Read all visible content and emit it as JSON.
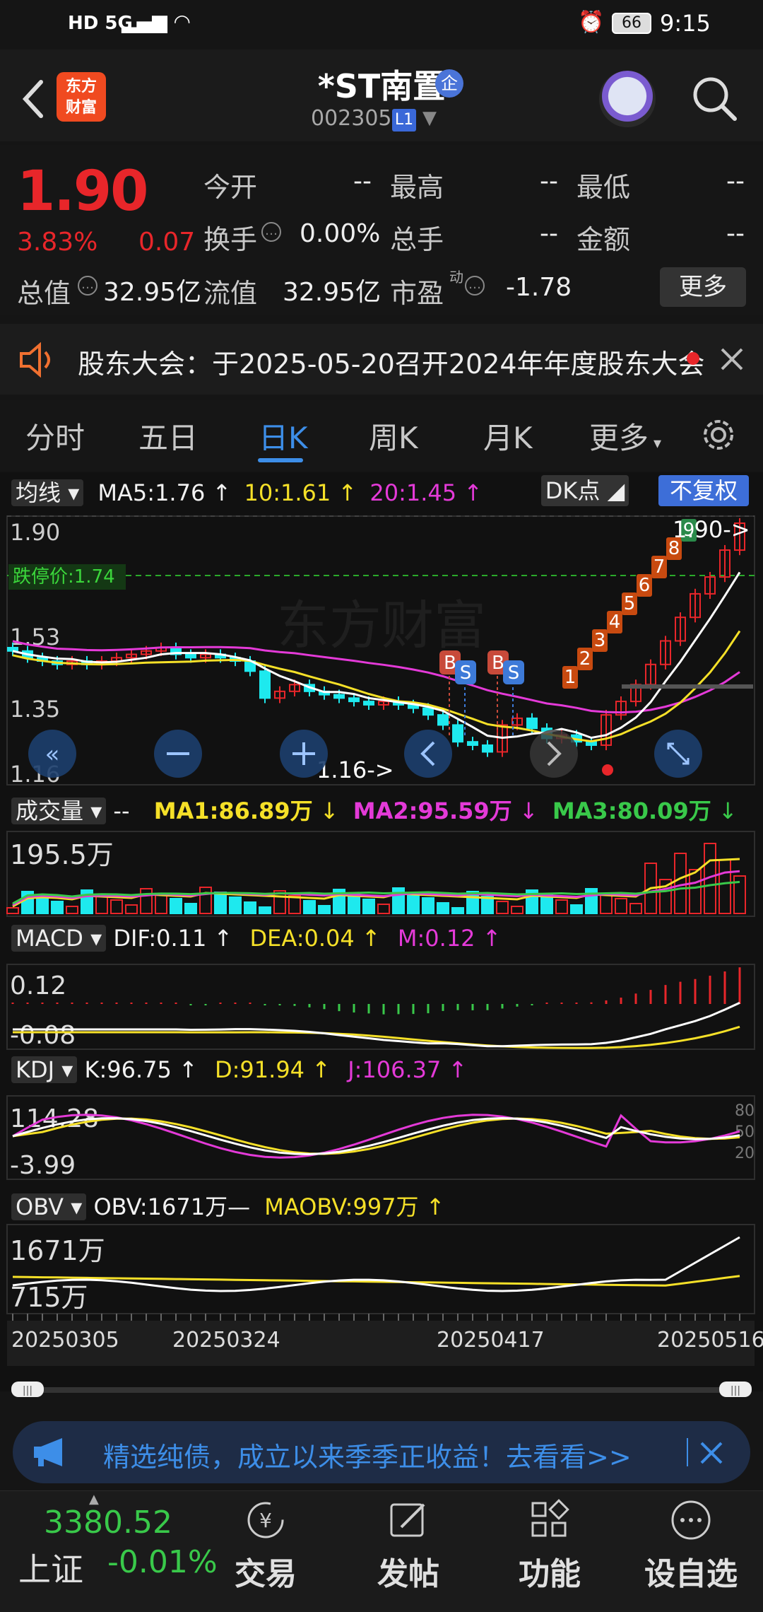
{
  "status_bar": {
    "left": "HD 5G",
    "battery": "66",
    "time": "9:15"
  },
  "header": {
    "back_icon": "chevron-left-icon",
    "logo_text": "东方\n财富",
    "title": "*ST南置",
    "badge": "企",
    "code": "002305",
    "level": "L1",
    "search_icon": "search-icon",
    "avatar_icon": "robot-avatar-icon"
  },
  "quote": {
    "price": "1.90",
    "change_pct": "3.83%",
    "change_amt": "0.07",
    "fields": {
      "open_label": "今开",
      "open_val": "--",
      "high_label": "最高",
      "high_val": "--",
      "low_label": "最低",
      "low_val": "--",
      "turnover_label": "换手",
      "turnover_val": "0.00%",
      "volume_label": "总手",
      "volume_val": "--",
      "amount_label": "金额",
      "amount_val": "--",
      "mktcap_label": "总值",
      "mktcap_val": "32.95亿",
      "float_label": "流值",
      "float_val": "32.95亿",
      "pe_label": "市盈",
      "pe_sup": "动",
      "pe_val": "-1.78"
    },
    "more_label": "更多"
  },
  "notice": {
    "text": "股东大会：于2025-05-20召开2024年年度股东大会"
  },
  "tabs": [
    {
      "label": "分时"
    },
    {
      "label": "五日"
    },
    {
      "label": "日K"
    },
    {
      "label": "周K"
    },
    {
      "label": "月K"
    },
    {
      "label": "更多"
    }
  ],
  "kline": {
    "ma_selector": "均线",
    "ma5": "MA5:1.76",
    "ma10": "10:1.61",
    "ma20": "20:1.45",
    "dk_label": "DK点",
    "adjust_label": "不复权",
    "y_top": "1.90",
    "y_mid1": "1.53",
    "y_mid2": "1.35",
    "y_bottom": "1.16",
    "limit_label": "跌停价:1.74",
    "high_marker": "1.90->",
    "low_marker": "1.16->",
    "td_numbers": [
      "1",
      "2",
      "3",
      "4",
      "5",
      "6",
      "7",
      "8",
      "9"
    ],
    "bs_markers": [
      "B",
      "S",
      "B",
      "S"
    ],
    "watermark": "东方财富"
  },
  "volume": {
    "selector": "成交量",
    "dash": "--",
    "ma1": "MA1:86.89万",
    "ma2": "MA2:95.59万",
    "ma3": "MA3:80.09万",
    "y_top": "195.5万"
  },
  "macd": {
    "selector": "MACD",
    "dif": "DIF:0.11",
    "dea": "DEA:0.04",
    "m": "M:0.12",
    "y_top": "0.12",
    "y_bottom": "-0.08"
  },
  "kdj": {
    "selector": "KDJ",
    "k": "K:96.75",
    "d": "D:91.94",
    "j": "J:106.37",
    "y_top": "114.28",
    "y_bottom": "-3.99",
    "levels": [
      "80",
      "50",
      "20"
    ]
  },
  "obv": {
    "selector": "OBV",
    "obv": "OBV:1671万",
    "maobv": "MAOBV:997万",
    "y_top": "1671万",
    "y_bottom": "715万"
  },
  "dates": [
    "20250305",
    "20250324",
    "20250417",
    "20250516"
  ],
  "ad": {
    "text": "精选纯债，成立以来季季正收益！去看看>>"
  },
  "bottom_nav": {
    "index_value": "3380.52",
    "index_name": "上证",
    "index_change": "-0.01%",
    "items": [
      {
        "label": "交易",
        "icon": "yen-exchange-icon"
      },
      {
        "label": "发帖",
        "icon": "edit-icon"
      },
      {
        "label": "功能",
        "icon": "grid-apps-icon"
      },
      {
        "label": "设自选",
        "icon": "more-dots-icon"
      }
    ]
  },
  "colors": {
    "up": "#e8262a",
    "down": "#1ee9ee",
    "accent": "#3d8ee8",
    "ma5": "#ffffff",
    "ma10": "#f5e028",
    "ma20": "#e43ad8"
  }
}
